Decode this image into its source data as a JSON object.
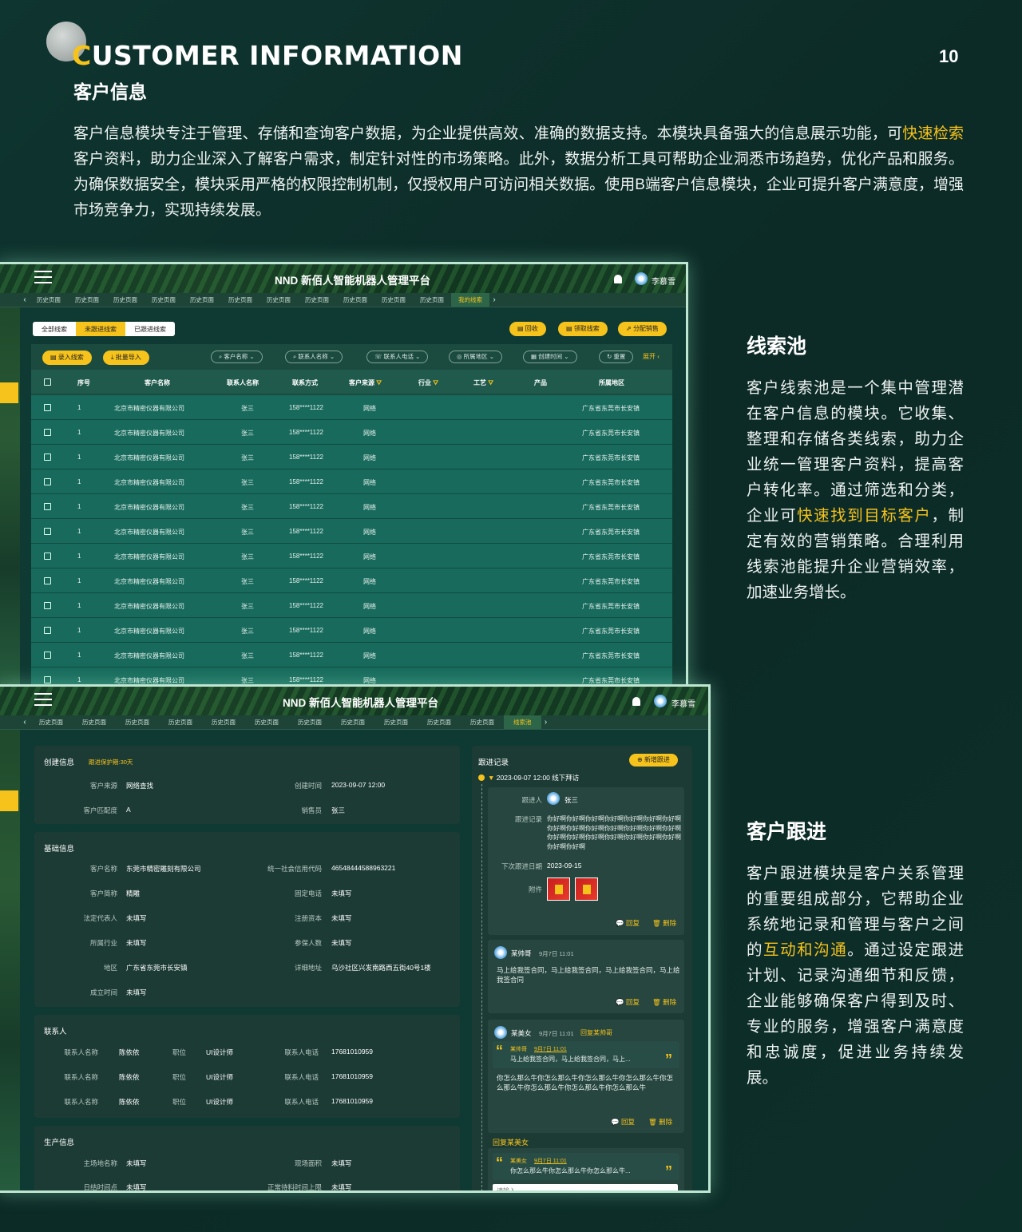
{
  "header": {
    "title_en_first": "C",
    "title_en_rest": "USTOMER INFORMATION",
    "title_cn": "客户信息",
    "page_no": "10"
  },
  "intro": {
    "p1": "客户信息模块专注于管理、存储和查询客户数据，为企业提供高效、准确的数据支持。本模块具备强大的信息展示功能，可",
    "p1_hl": "快速检索",
    "p2": "客户资料，助力企业深入了解客户需求，制定针对性的市场策略。此外，数据分析工具可帮助企业洞悉市场趋势，优化产品和服务。为确保数据安全，模块采用严格的权限控制机制，仅授权用户可访问相关数据。使用B端客户信息模块，企业可提升客户满意度，增强市场竞争力，实现持续发展。"
  },
  "section1": {
    "heading": "线索池",
    "text_a": "客户线索池是一个集中管理潜在客户信息的模块。它收集、整理和存储各类线索，助力企业统一管理客户资料，提高客户转化率。通过筛选和分类，企业可",
    "text_hl": "快速找到目标客户",
    "text_b": "，制定有效的营销策略。合理利用线索池能提升企业营销效率，加速业务增长。"
  },
  "section2": {
    "heading": "客户跟进",
    "text_a": "客户跟进模块是客户关系管理的重要组成部分，它帮助企业系统地记录和管理与客户之间的",
    "text_hl": "互动和沟通",
    "text_b": "。通过设定跟进计划、记录沟通细节和反馈，企业能够确保客户得到及时、专业的服务，增强客户满意度和忠诚度，促进业务持续发展。"
  },
  "app": {
    "title": "NND 新佰人智能机器人管理平台",
    "user": "李慕雪",
    "history_tab": "历史页面",
    "tab_list_active": "我的线索",
    "tab_detail_active": "线索池"
  },
  "list": {
    "seg": [
      "全部线索",
      "未跟进线索",
      "已跟进线索"
    ],
    "actions": [
      "回收",
      "领取线索",
      "分配销售"
    ],
    "add_btn": "录入线索",
    "import_btn": "批量导入",
    "filters": [
      "客户名称",
      "联系人名称",
      "联系人电话",
      "所属地区",
      "创建时间"
    ],
    "reset": "重置",
    "expand": "展开",
    "columns": [
      "序号",
      "客户名称",
      "联系人名称",
      "联系方式",
      "客户来源",
      "行业",
      "工艺",
      "产品",
      "所属地区"
    ],
    "rows": [
      [
        "1",
        "北京市精密仪器有限公司",
        "张三",
        "158****1122",
        "网络",
        "",
        "",
        "",
        "广东省东莞市长安镇"
      ],
      [
        "1",
        "北京市精密仪器有限公司",
        "张三",
        "158****1122",
        "网络",
        "",
        "",
        "",
        "广东省东莞市长安镇"
      ],
      [
        "1",
        "北京市精密仪器有限公司",
        "张三",
        "158****1122",
        "网络",
        "",
        "",
        "",
        "广东省东莞市长安镇"
      ],
      [
        "1",
        "北京市精密仪器有限公司",
        "张三",
        "158****1122",
        "网络",
        "",
        "",
        "",
        "广东省东莞市长安镇"
      ],
      [
        "1",
        "北京市精密仪器有限公司",
        "张三",
        "158****1122",
        "网络",
        "",
        "",
        "",
        "广东省东莞市长安镇"
      ],
      [
        "1",
        "北京市精密仪器有限公司",
        "张三",
        "158****1122",
        "网络",
        "",
        "",
        "",
        "广东省东莞市长安镇"
      ],
      [
        "1",
        "北京市精密仪器有限公司",
        "张三",
        "158****1122",
        "网络",
        "",
        "",
        "",
        "广东省东莞市长安镇"
      ],
      [
        "1",
        "北京市精密仪器有限公司",
        "张三",
        "158****1122",
        "网络",
        "",
        "",
        "",
        "广东省东莞市长安镇"
      ],
      [
        "1",
        "北京市精密仪器有限公司",
        "张三",
        "158****1122",
        "网络",
        "",
        "",
        "",
        "广东省东莞市长安镇"
      ],
      [
        "1",
        "北京市精密仪器有限公司",
        "张三",
        "158****1122",
        "网络",
        "",
        "",
        "",
        "广东省东莞市长安镇"
      ],
      [
        "1",
        "北京市精密仪器有限公司",
        "张三",
        "158****1122",
        "网络",
        "",
        "",
        "",
        "广东省东莞市长安镇"
      ],
      [
        "1",
        "北京市精密仪器有限公司",
        "张三",
        "158****1122",
        "网络",
        "",
        "",
        "",
        "广东省东莞市长安镇"
      ]
    ]
  },
  "detail": {
    "create": {
      "title": "创建信息",
      "badge": "跟进保护期:30天",
      "fields": [
        [
          "客户来源",
          "网络查找"
        ],
        [
          "创建时间",
          "2023-09-07 12:00"
        ],
        [
          "客户匹配度",
          "A"
        ],
        [
          "销售员",
          "张三"
        ]
      ]
    },
    "basic": {
      "title": "基础信息",
      "fields": [
        [
          "客户名称",
          "东莞市精密雕刻有限公司"
        ],
        [
          "统一社会信用代码",
          "46548444588963221"
        ],
        [
          "客户简称",
          "精雕"
        ],
        [
          "固定电话",
          "未填写"
        ],
        [
          "法定代表人",
          "未填写"
        ],
        [
          "注册资本",
          "未填写"
        ],
        [
          "所属行业",
          "未填写"
        ],
        [
          "参保人数",
          "未填写"
        ],
        [
          "地区",
          "广东省东莞市长安镇"
        ],
        [
          "详细地址",
          "乌沙社区兴发南路西五街40号1楼"
        ],
        [
          "成立时间",
          "未填写"
        ]
      ]
    },
    "contacts": {
      "title": "联系人",
      "rows": [
        [
          "联系人名称",
          "陈依依",
          "职位",
          "UI设计师",
          "联系人电话",
          "17681010959"
        ],
        [
          "联系人名称",
          "陈依依",
          "职位",
          "UI设计师",
          "联系人电话",
          "17681010959"
        ],
        [
          "联系人名称",
          "陈依依",
          "职位",
          "UI设计师",
          "联系人电话",
          "17681010959"
        ]
      ]
    },
    "production": {
      "title": "生产信息",
      "fields": [
        [
          "主场地名称",
          "未填写"
        ],
        [
          "现场面积",
          "未填写"
        ],
        [
          "日结时间点",
          "未填写"
        ],
        [
          "正常待料时间上限",
          "未填写"
        ]
      ]
    },
    "follow": {
      "title": "跟进记录",
      "add_btn": "新增跟进",
      "entry_head": "2023-09-07 12:00 线下拜访",
      "follower_label": "跟进人",
      "follower": "张三",
      "record_label": "跟进记录",
      "record_text": "你好啊你好啊你好啊你好啊你好啊你好啊你好啊你好啊你好啊你好啊你好啊你好啊你好啊你好啊你好啊你好啊你好啊你好啊你好啊你好啊你好啊你好啊你好啊",
      "next_label": "下次跟进日期",
      "next_date": "2023-09-15",
      "attach_label": "附件",
      "reply": "回复",
      "delete": "删除",
      "c1_name": "某帅哥",
      "c1_time": "9月7日 11:01",
      "c1_text": "马上给我签合同，马上给我签合同，马上给我签合同，马上给我签合同",
      "c2_name": "某美女",
      "c2_time": "9月7日 11:01",
      "c2_reply_to": "回复某帅哥",
      "c2_quote_name": "某帅哥",
      "c2_quote_time": "9月7日 11:01",
      "c2_quote_text": "马上给我签合同，马上给我签合同，马上...",
      "c2_text": "你怎么那么牛你怎么那么牛你怎么那么牛你怎么那么牛你怎么那么牛你怎么那么牛你怎么那么牛你怎么那么牛",
      "reply_to_label": "回复某美女",
      "q2_name": "某美女",
      "q2_time": "9月7日 11:01",
      "q2_text": "你怎么那么牛你怎么那么牛你怎么那么牛...",
      "input_placeholder": "请输入"
    }
  }
}
